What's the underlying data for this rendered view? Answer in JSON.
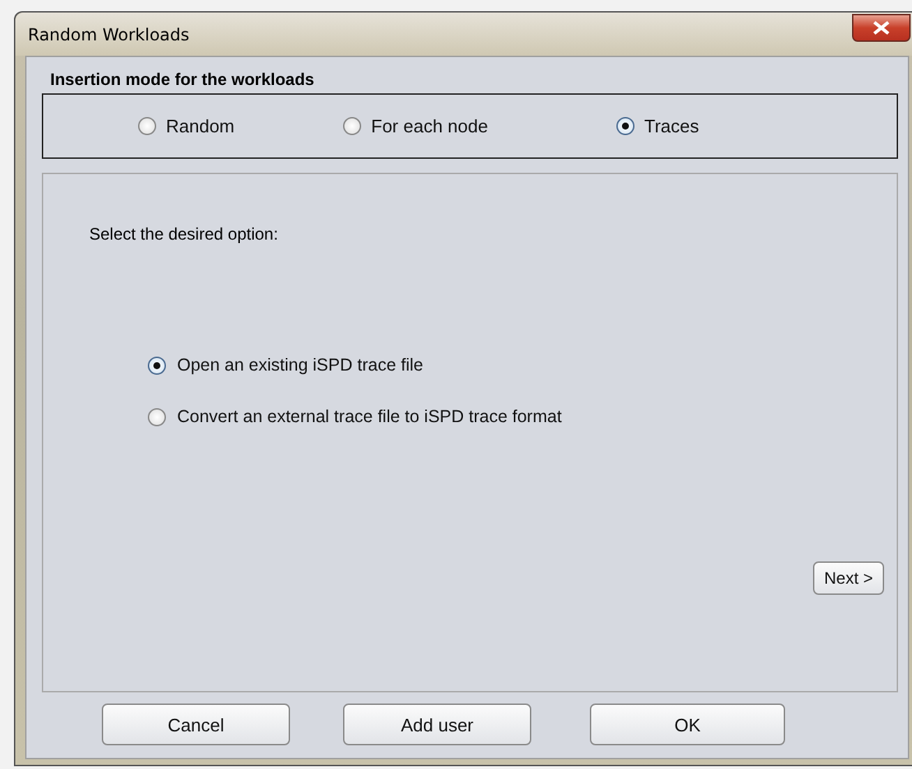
{
  "window": {
    "title": "Random Workloads"
  },
  "insertion_mode": {
    "title": "Insertion mode for the workloads",
    "options": [
      {
        "label": "Random",
        "selected": false
      },
      {
        "label": "For each node",
        "selected": false
      },
      {
        "label": "Traces",
        "selected": true
      }
    ]
  },
  "panel": {
    "prompt": "Select the desired option:",
    "options": [
      {
        "label": "Open an existing iSPD trace file",
        "selected": true
      },
      {
        "label": "Convert an external trace file to iSPD trace format",
        "selected": false
      }
    ],
    "next_button": "Next >"
  },
  "buttons": [
    "Cancel",
    "Add user",
    "OK"
  ]
}
